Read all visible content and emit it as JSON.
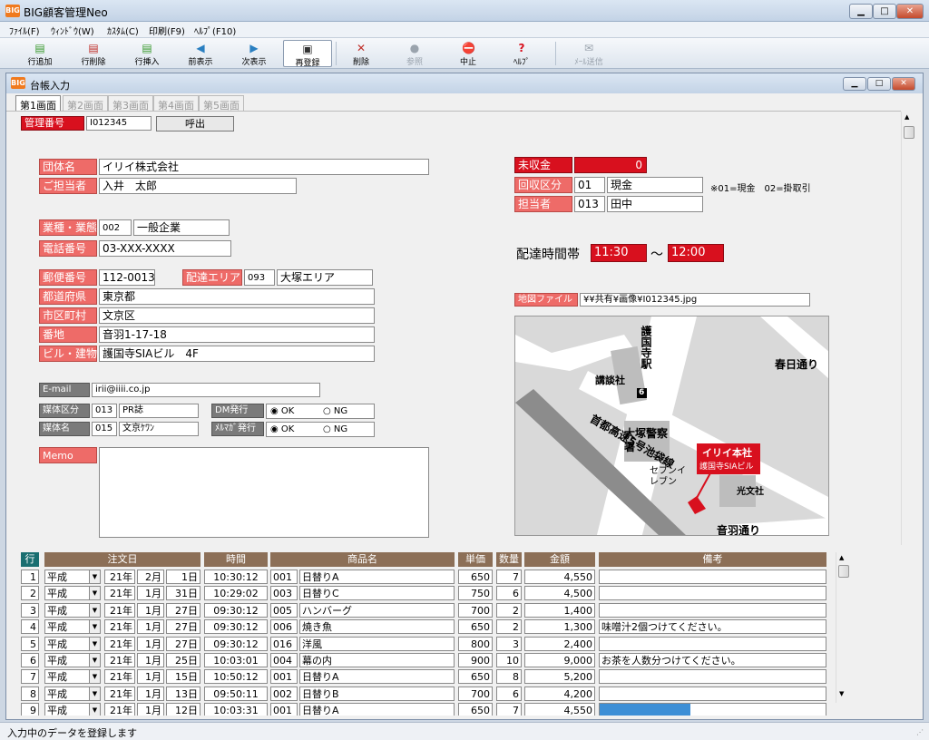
{
  "window": {
    "title": "BIG顧客管理Neo",
    "icon": "BIG"
  },
  "menu": [
    "ﾌｧｲﾙ(F)",
    "ｳｨﾝﾄﾞｳ(W)",
    "ｶｽﾀﾑ(C)",
    "印刷(F9)",
    "ﾍﾙﾌﾟ(F10)"
  ],
  "toolbar": [
    {
      "label": "行追加",
      "icon": "row-add-icon",
      "glyph": "▤",
      "color": "#3a9a2f"
    },
    {
      "label": "行削除",
      "icon": "row-delete-icon",
      "glyph": "▤",
      "color": "#c0302a"
    },
    {
      "label": "行挿入",
      "icon": "row-insert-icon",
      "glyph": "▤",
      "color": "#3a9a2f"
    },
    {
      "label": "前表示",
      "icon": "prev-icon",
      "glyph": "◀",
      "color": "#2a7fc1"
    },
    {
      "label": "次表示",
      "icon": "next-icon",
      "glyph": "▶",
      "color": "#2a7fc1"
    },
    {
      "label": "再登録",
      "icon": "save-icon",
      "glyph": "▣",
      "color": "#333"
    },
    {
      "label": "削除",
      "icon": "delete-icon",
      "glyph": "✕",
      "color": "#c0302a"
    },
    {
      "label": "参照",
      "icon": "refer-icon",
      "glyph": "●",
      "color": "#9aa3ad"
    },
    {
      "label": "中止",
      "icon": "stop-icon",
      "glyph": "⛔",
      "color": "#d8101e"
    },
    {
      "label": "ﾍﾙﾌﾟ",
      "icon": "help-icon",
      "glyph": "?",
      "color": "#d8101e"
    },
    {
      "label": "ﾒｰﾙ送信",
      "icon": "mail-icon",
      "glyph": "✉",
      "color": "#9aa3ad"
    }
  ],
  "child": {
    "title": "台帳入力",
    "icon": "BIG"
  },
  "tabs": [
    "第1画面",
    "第2画面",
    "第3画面",
    "第4画面",
    "第5画面"
  ],
  "form": {
    "kanri_label": "管理番号",
    "kanri_value": "I012345",
    "call_button": "呼出",
    "dantai_label": "団体名",
    "dantai_value": "イリイ株式会社",
    "tanto_label": "ご担当者",
    "tanto_value": "入井　太郎",
    "gyoshu_label": "業種・業態",
    "gyoshu_code": "002",
    "gyoshu_value": "一般企業",
    "tel_label": "電話番号",
    "tel_value": "03-XXX-XXXX",
    "zip_label": "郵便番号",
    "zip_value": "112-0013",
    "area_label": "配達エリア",
    "area_code": "093",
    "area_value": "大塚エリア",
    "pref_label": "都道府県",
    "pref_value": "東京都",
    "city_label": "市区町村",
    "city_value": "文京区",
    "addr_label": "番地",
    "addr_value": "音羽1-17-18",
    "bldg_label": "ビル・建物",
    "bldg_value": "護国寺SIAビル　4F",
    "email_label": "E-mail",
    "email_value": "irii@iiii.co.jp",
    "media_label": "媒体区分",
    "media_code": "013",
    "media_value": "PR誌",
    "dm_label": "DM発行",
    "radio_ok": "OK",
    "radio_ng": "NG",
    "medianame_label": "媒体名",
    "medianame_code": "015",
    "medianame_value": "文京ｹﾜﾝ",
    "mailmag_label": "ﾒﾙﾏｶﾞ発行",
    "memo_label": "Memo",
    "mishu_label": "未収金",
    "mishu_value": "0",
    "kaishu_label": "回収区分",
    "kaishu_code": "01",
    "kaishu_value": "現金",
    "kaishu_note": "※01=現金　02=掛取引",
    "tantosha_label": "担当者",
    "tantosha_code": "013",
    "tantosha_value": "田中",
    "delivery_label": "配達時間帯",
    "delivery_from": "11:30",
    "delivery_sep": "～",
    "delivery_to": "12:00",
    "mapfile_label": "地図ファイル",
    "mapfile_value": "¥¥共有¥画像¥I012345.jpg"
  },
  "map": {
    "gokokuji": "護国寺駅",
    "kodansha": "講談社",
    "exit": "6",
    "kasuga": "春日通り",
    "highway": "首都高速5号池袋線",
    "police": "大塚警察署",
    "seven": "セブンイレブン",
    "koubunsha": "光文社",
    "otowa": "音羽通り",
    "callout_title": "イリイ本社",
    "callout_sub": "護国寺SIAビル"
  },
  "table": {
    "headers": {
      "row": "行",
      "date": "注文日",
      "time": "時間",
      "product": "商品名",
      "price": "単価",
      "qty": "数量",
      "amount": "金額",
      "note": "備考"
    },
    "rows": [
      {
        "no": "1",
        "era": "平成",
        "y": "21年",
        "m": "2月",
        "d": "1日",
        "time": "10:30:12",
        "code": "001",
        "product": "日替りA",
        "price": "650",
        "qty": "7",
        "amount": "4,550",
        "note": ""
      },
      {
        "no": "2",
        "era": "平成",
        "y": "21年",
        "m": "1月",
        "d": "31日",
        "time": "10:29:02",
        "code": "003",
        "product": "日替りC",
        "price": "750",
        "qty": "6",
        "amount": "4,500",
        "note": ""
      },
      {
        "no": "3",
        "era": "平成",
        "y": "21年",
        "m": "1月",
        "d": "27日",
        "time": "09:30:12",
        "code": "005",
        "product": "ハンバーグ",
        "price": "700",
        "qty": "2",
        "amount": "1,400",
        "note": ""
      },
      {
        "no": "4",
        "era": "平成",
        "y": "21年",
        "m": "1月",
        "d": "27日",
        "time": "09:30:12",
        "code": "006",
        "product": "焼き魚",
        "price": "650",
        "qty": "2",
        "amount": "1,300",
        "note": "味噌汁2個つけてください。"
      },
      {
        "no": "5",
        "era": "平成",
        "y": "21年",
        "m": "1月",
        "d": "27日",
        "time": "09:30:12",
        "code": "016",
        "product": "洋風",
        "price": "800",
        "qty": "3",
        "amount": "2,400",
        "note": ""
      },
      {
        "no": "6",
        "era": "平成",
        "y": "21年",
        "m": "1月",
        "d": "25日",
        "time": "10:03:01",
        "code": "004",
        "product": "幕の内",
        "price": "900",
        "qty": "10",
        "amount": "9,000",
        "note": "お茶を人数分つけてください。"
      },
      {
        "no": "7",
        "era": "平成",
        "y": "21年",
        "m": "1月",
        "d": "15日",
        "time": "10:50:12",
        "code": "001",
        "product": "日替りA",
        "price": "650",
        "qty": "8",
        "amount": "5,200",
        "note": ""
      },
      {
        "no": "8",
        "era": "平成",
        "y": "21年",
        "m": "1月",
        "d": "13日",
        "time": "09:50:11",
        "code": "002",
        "product": "日替りB",
        "price": "700",
        "qty": "6",
        "amount": "4,200",
        "note": ""
      },
      {
        "no": "9",
        "era": "平成",
        "y": "21年",
        "m": "1月",
        "d": "12日",
        "time": "10:03:31",
        "code": "001",
        "product": "日替りA",
        "price": "650",
        "qty": "7",
        "amount": "4,550",
        "note": ""
      }
    ]
  },
  "status": "入力中のデータを登録します"
}
